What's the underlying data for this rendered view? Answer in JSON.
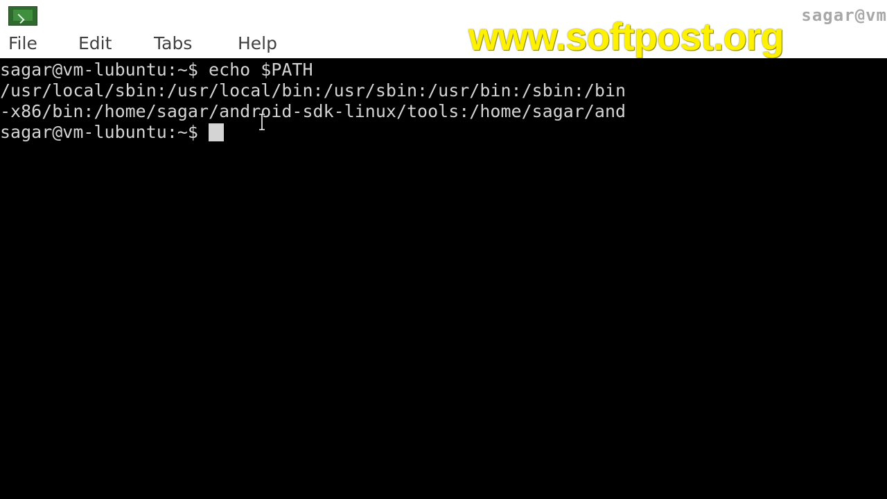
{
  "window": {
    "title": "sagar@vm"
  },
  "menu": {
    "items": [
      "File",
      "Edit",
      "Tabs",
      "Help"
    ]
  },
  "watermark": {
    "text": "www.softpost.org",
    "color": "#fff200"
  },
  "terminal": {
    "lines": [
      "sagar@vm-lubuntu:~$ echo $PATH",
      "/usr/local/sbin:/usr/local/bin:/usr/sbin:/usr/bin:/sbin:/bin",
      "-x86/bin:/home/sagar/android-sdk-linux/tools:/home/sagar/and",
      "sagar@vm-lubuntu:~$ "
    ],
    "text_color": "#d4d4d4",
    "background": "#000000"
  },
  "icons": {
    "app_icon": "terminal-icon",
    "pointer": "text-cursor-icon"
  }
}
